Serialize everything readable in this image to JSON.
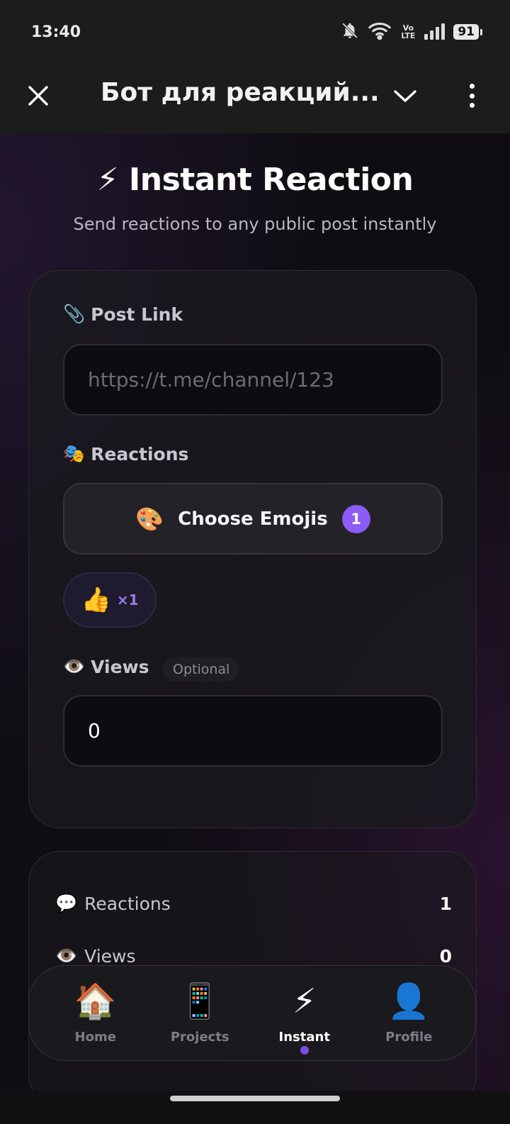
{
  "status_bar": {
    "time": "13:40",
    "network_label": "Vo LTE",
    "battery": "91",
    "icons": [
      "bell-muted-icon",
      "wifi-icon",
      "volte-icon",
      "signal-icon",
      "battery-icon"
    ]
  },
  "top_bar": {
    "title": "Бот для реакций...",
    "icons": [
      "close-icon",
      "chevron-down-icon",
      "more-vertical-icon"
    ]
  },
  "hero": {
    "icon": "⚡",
    "title": "Instant Reaction",
    "subtitle": "Send reactions to any public post instantly"
  },
  "form": {
    "post_link": {
      "icon": "📎",
      "label": "Post Link",
      "placeholder": "https://t.me/channel/123",
      "value": ""
    },
    "reactions": {
      "icon": "🎭",
      "label": "Reactions",
      "choose_button": {
        "icon": "🎨",
        "label": "Choose Emojis",
        "badge": "1"
      },
      "selected": [
        {
          "emoji": "👍",
          "count_label": "×1"
        }
      ]
    },
    "views": {
      "icon": "👁️",
      "label": "Views",
      "tag": "Optional",
      "value": "0"
    }
  },
  "summary": {
    "rows": [
      {
        "icon": "💬",
        "label": "Reactions",
        "value": "1"
      },
      {
        "icon": "👁️",
        "label": "Views",
        "value": "0"
      }
    ]
  },
  "bottom_nav": {
    "items": [
      {
        "icon": "🏠",
        "label": "Home",
        "active": false
      },
      {
        "icon": "📱",
        "label": "Projects",
        "active": false
      },
      {
        "icon": "⚡",
        "label": "Instant",
        "active": true
      },
      {
        "icon": "👤",
        "label": "Profile",
        "active": false
      }
    ]
  },
  "colors": {
    "accent": "#8b5cf6",
    "background": "#0f0d12",
    "card": "#1a191e",
    "bar": "#1c1c1c"
  }
}
